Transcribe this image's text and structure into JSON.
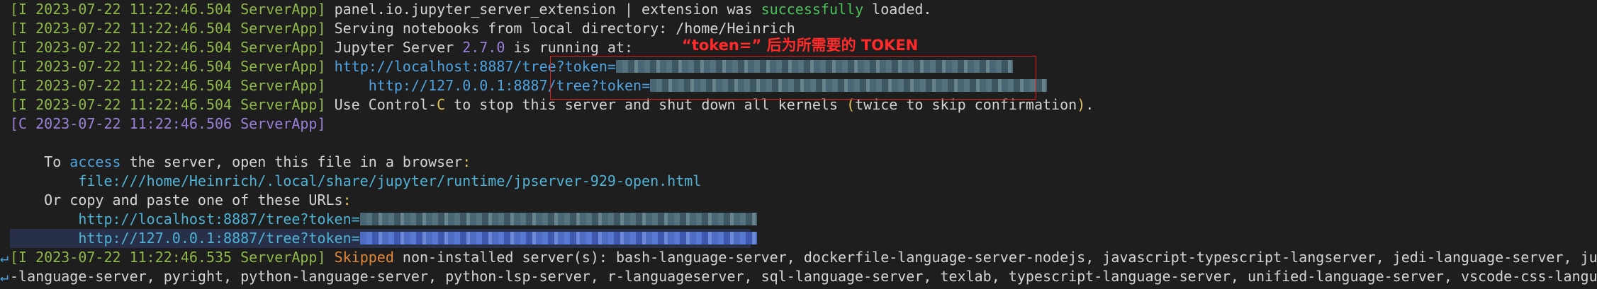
{
  "annotation": "“token=” 后为所需要的 TOKEN",
  "wrap_marker": "↵",
  "lines": [
    {
      "prefix": "[I 2023-07-22 11:22:46.504 ServerApp]",
      "a": " panel.io.jupyter_server_extension | extension was ",
      "b": "successfully",
      "c": " loaded."
    },
    {
      "prefix": "[I 2023-07-22 11:22:46.504 ServerApp]",
      "a": " Serving notebooks from local directory: /home/Heinrich"
    },
    {
      "prefix": "[I 2023-07-22 11:22:46.504 ServerApp]",
      "a": " Jupyter Server ",
      "b": "2.7.0",
      "c": " is running at:"
    },
    {
      "prefix": "[I 2023-07-22 11:22:46.504 ServerApp]",
      "a": " ",
      "b": "http://localhost:8887/tree?token="
    },
    {
      "prefix": "[I 2023-07-22 11:22:46.504 ServerApp]",
      "a": "     ",
      "b": "http://127.0.0.1:8887/tree?token="
    },
    {
      "prefix": "[I 2023-07-22 11:22:46.504 ServerApp]",
      "a": " Use Control-",
      "b": "C",
      "c": " to stop this server and shut down all kernels ",
      "d": "(",
      "e": "twice to skip confirmation",
      "f": ")",
      "g": "."
    },
    {
      "prefix": "[C 2023-07-22 11:22:46.506 ServerApp]"
    },
    {
      "text": ""
    },
    {
      "a": "    To ",
      "b": "access",
      "c": " the server, open this file in a browser",
      "d": ":"
    },
    {
      "a": "        ",
      "b": "file:///home/Heinrich/.local/share/jupyter/runtime/jpserver-929-open.html"
    },
    {
      "a": "    Or copy and paste one of these URLs",
      "b": ":"
    },
    {
      "a": "        ",
      "b": "http://localhost:8887/tree?token="
    },
    {
      "a": "        ",
      "b": "http://127.0.0.1:8887/tree?token="
    },
    {
      "prefix": "[I 2023-07-22 11:22:46.535 ServerApp]",
      "a": " ",
      "b": "Skipped",
      "c": " non-installed server(s): bash-language-server, dockerfile-language-server-nodejs, javascript-typescript-langserver, jedi-language-server, julia"
    },
    {
      "a": "-language-server, pyright, python-language-server, python-lsp-server, r-languageserver, sql-language-server, texlab, typescript-language-server, unified-language-server, vscode-css-language"
    }
  ]
}
